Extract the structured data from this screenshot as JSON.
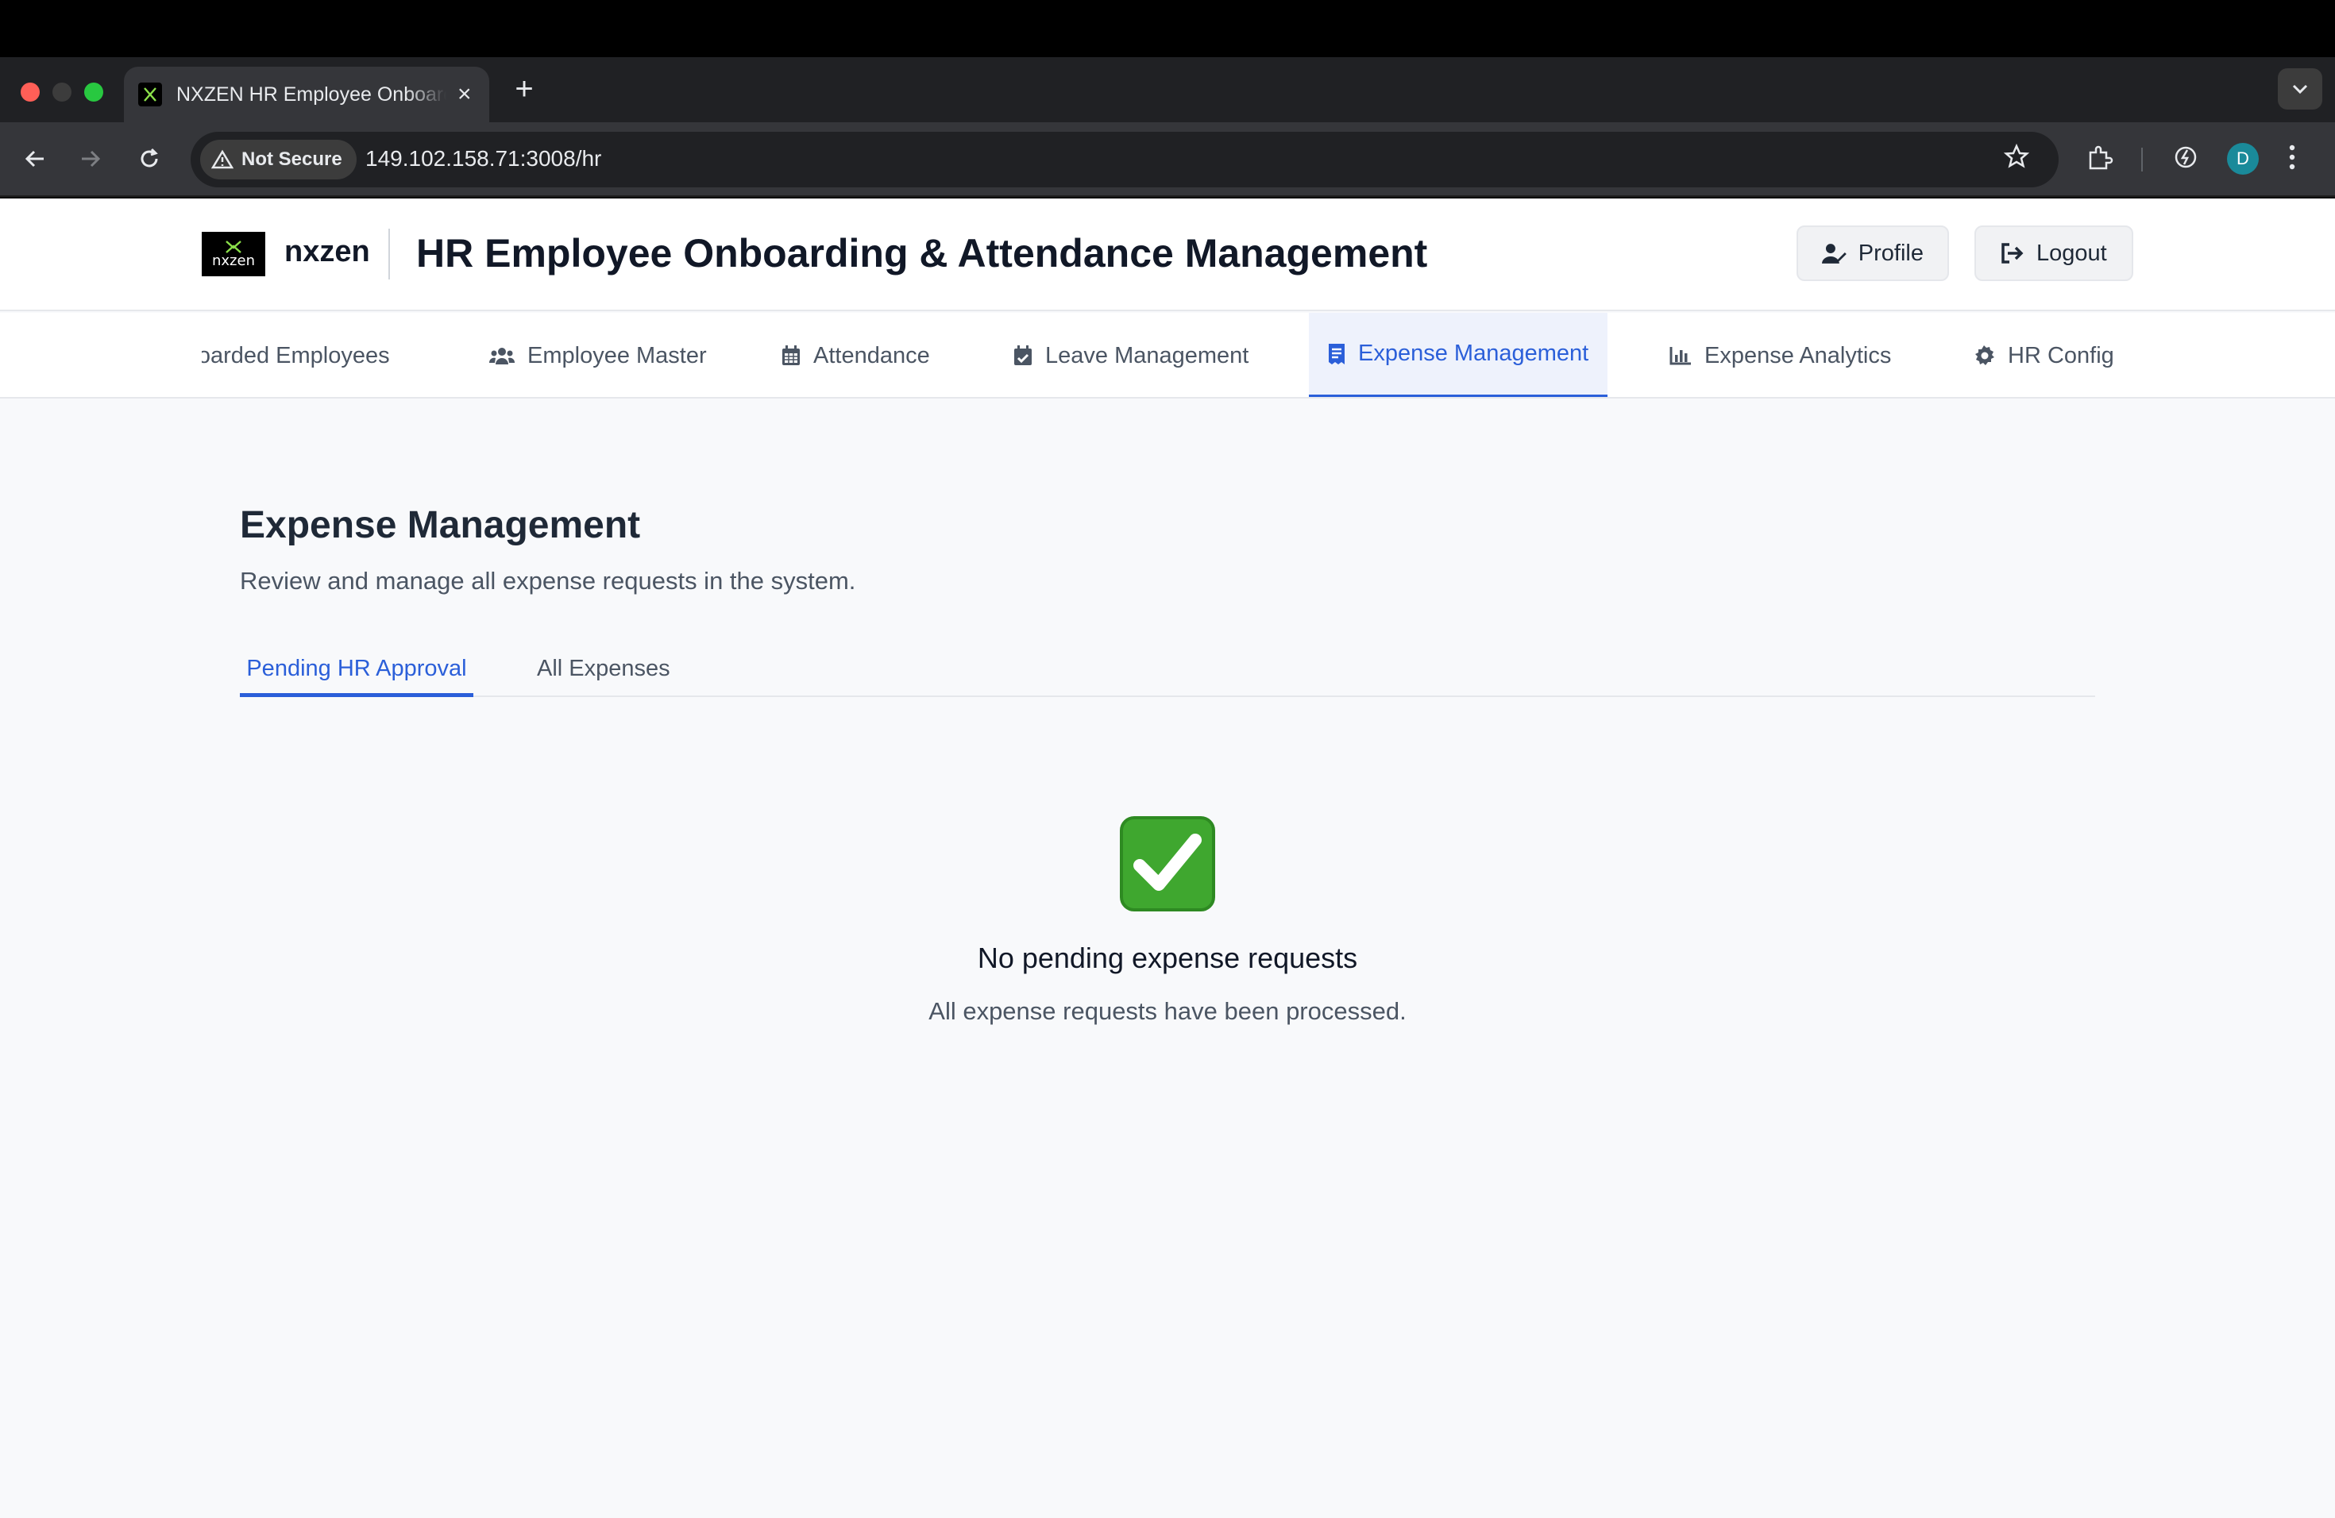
{
  "browser": {
    "tab_title": "NXZEN HR Employee Onboarding & Attendance Management",
    "new_tab": "+",
    "close": "×",
    "security_label": "Not Secure",
    "url": "149.102.158.71:3008/hr",
    "avatar_letter": "D"
  },
  "header": {
    "logo_text": "nxzen",
    "brand": "nxzen",
    "title": "HR Employee Onboarding & Attendance Management",
    "profile_label": "Profile",
    "logout_label": "Logout"
  },
  "nav": {
    "items": [
      {
        "label": "Onboarded Employees",
        "icon": "users-icon"
      },
      {
        "label": "Employee Master",
        "icon": "users-icon"
      },
      {
        "label": "Attendance",
        "icon": "calendar-icon"
      },
      {
        "label": "Leave Management",
        "icon": "calendar-check-icon"
      },
      {
        "label": "Expense Management",
        "icon": "receipt-icon"
      },
      {
        "label": "Expense Analytics",
        "icon": "bar-chart-icon"
      },
      {
        "label": "HR Config",
        "icon": "gear-icon"
      }
    ],
    "active": "Expense Management"
  },
  "main": {
    "title": "Expense Management",
    "subtitle": "Review and manage all expense requests in the system.",
    "tabs": [
      {
        "label": "Pending HR Approval",
        "active": true
      },
      {
        "label": "All Expenses",
        "active": false
      }
    ],
    "empty_state": {
      "icon": "check-mark-icon",
      "title": "No pending expense requests",
      "message": "All expense requests have been processed."
    }
  },
  "colors": {
    "accent": "#2b5fd9",
    "check_green": "#3fa72f"
  }
}
